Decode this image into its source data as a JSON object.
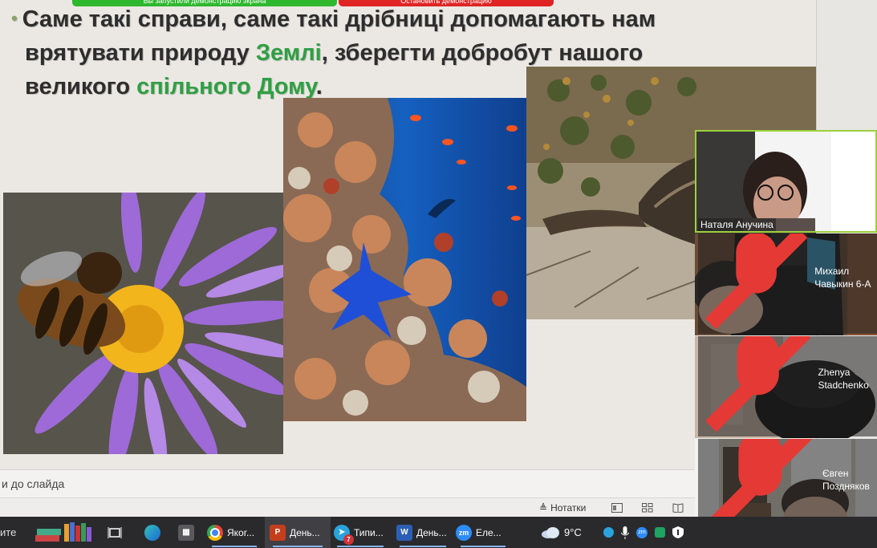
{
  "slide": {
    "line1": "Саме такі справи, саме такі дрібниці допомагають нам",
    "line2_a": "врятувати природу ",
    "line2_green": "Землі",
    "line2_b": ", зберегти добробут нашого",
    "line3_a": "великого ",
    "line3_green": "спільного Дому",
    "line3_b": ".",
    "bullet": "•"
  },
  "zoom_banner": {
    "left_text": "Вы запустили демонстрацию экрана",
    "right_text": "Остановить демонстрацию"
  },
  "notes": {
    "placeholder": "и до слайда"
  },
  "status": {
    "notes_label": "Нотатки"
  },
  "participants": [
    {
      "name": "Наталя Анучина",
      "muted": false,
      "speaking": true
    },
    {
      "name": "Михаил Чавыкин 6-А",
      "muted": true,
      "speaking": false
    },
    {
      "name": "Zhenya Stadchenko",
      "muted": true,
      "speaking": false
    },
    {
      "name": "Євген Поздняков",
      "muted": true,
      "speaking": false
    }
  ],
  "taskbar": {
    "start_text": "ите",
    "apps": [
      {
        "label": "Якоr...",
        "icon": "chrome-icon"
      },
      {
        "label": "День...",
        "icon": "powerpoint-icon"
      },
      {
        "label": "Типи...",
        "icon": "telegram-icon",
        "badge": "7"
      },
      {
        "label": "День...",
        "icon": "word-icon"
      },
      {
        "label": "Еле...",
        "icon": "zoom-icon"
      }
    ],
    "weather": "9°C"
  },
  "colors": {
    "accent_green": "#2ea043",
    "taskbar_bg": "#2a2a2d",
    "zoom_green": "#2eb82e",
    "zoom_red": "#e02424"
  }
}
